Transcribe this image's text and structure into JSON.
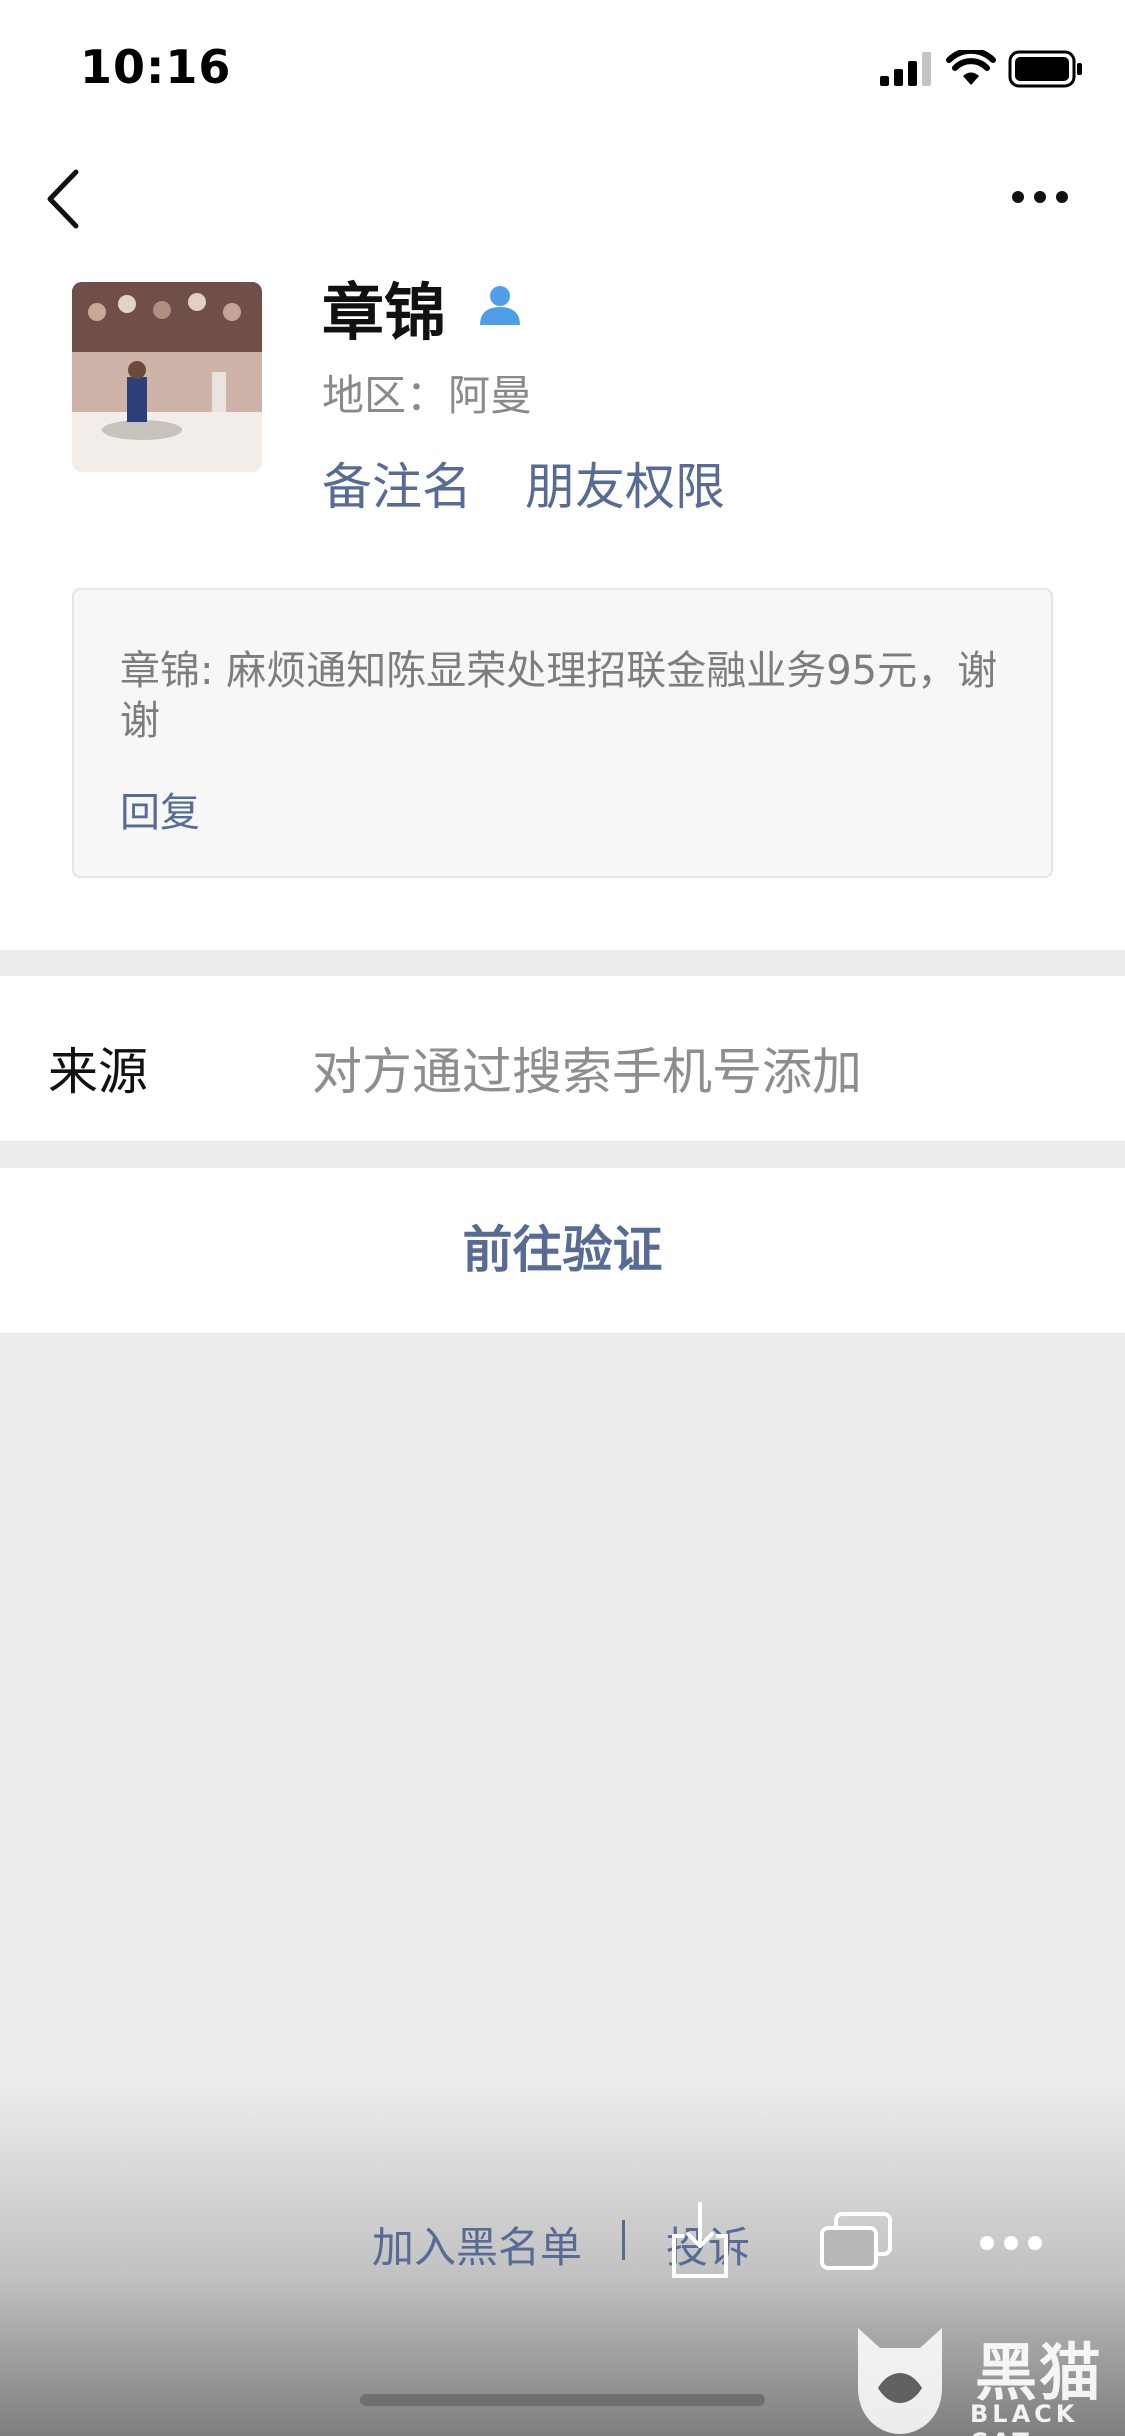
{
  "status_bar": {
    "time": "10:16"
  },
  "profile": {
    "name": "章锦",
    "region": "地区：阿曼",
    "remark_label": "备注名",
    "permission_label": "朋友权限"
  },
  "message": {
    "text": "章锦: 麻烦通知陈显荣处理招联金融业务95元，谢谢",
    "reply_label": "回复"
  },
  "source": {
    "label": "来源",
    "value": "对方通过搜索手机号添加"
  },
  "verify": {
    "label": "前往验证"
  },
  "bottom": {
    "blacklist_label": "加入黑名单",
    "complain_label": "投诉"
  },
  "watermark": {
    "name": "黑猫",
    "sub": "BLACK CAT"
  },
  "colors": {
    "link": "#576b95",
    "background": "#ededed",
    "card": "#f7f7f7"
  },
  "icons": {
    "back": "chevron-left-icon",
    "more": "more-dots-icon",
    "badge": "contact-badge-icon",
    "download": "download-icon",
    "windows": "windows-icon"
  }
}
